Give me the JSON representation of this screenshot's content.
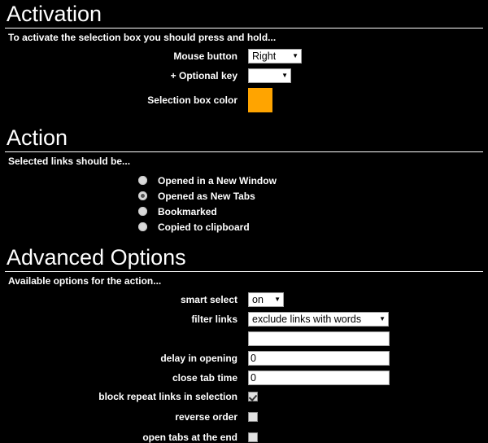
{
  "activation": {
    "title": "Activation",
    "subtitle": "To activate the selection box you should press and hold...",
    "mouse_button": {
      "label": "Mouse button",
      "value": "Right",
      "arrow": "chevron-down-icon"
    },
    "optional_key": {
      "label": "+ Optional key",
      "value": "",
      "arrow": "chevron-down-icon"
    },
    "selection_box_color": {
      "label": "Selection box color",
      "value": "#FFA400"
    }
  },
  "action": {
    "title": "Action",
    "subtitle": "Selected links should be...",
    "options": [
      {
        "label": "Opened in a New Window",
        "selected": false
      },
      {
        "label": "Opened as New Tabs",
        "selected": true
      },
      {
        "label": "Bookmarked",
        "selected": false
      },
      {
        "label": "Copied to clipboard",
        "selected": false
      }
    ]
  },
  "advanced": {
    "title": "Advanced Options",
    "subtitle": "Available options for the action...",
    "smart_select": {
      "label": "smart select",
      "value": "on"
    },
    "filter_links": {
      "label": "filter links",
      "value": "exclude links with words"
    },
    "filter_words": {
      "value": "",
      "placeholder": ""
    },
    "delay_in_opening": {
      "label": "delay in opening",
      "value": "0"
    },
    "close_tab_time": {
      "label": "close tab time",
      "value": "0"
    },
    "block_repeat_links": {
      "label": "block repeat links in selection",
      "checked": true
    },
    "reverse_order": {
      "label": "reverse order",
      "checked": false
    },
    "open_tabs_at_end": {
      "label": "open tabs at the end",
      "checked": false
    }
  }
}
